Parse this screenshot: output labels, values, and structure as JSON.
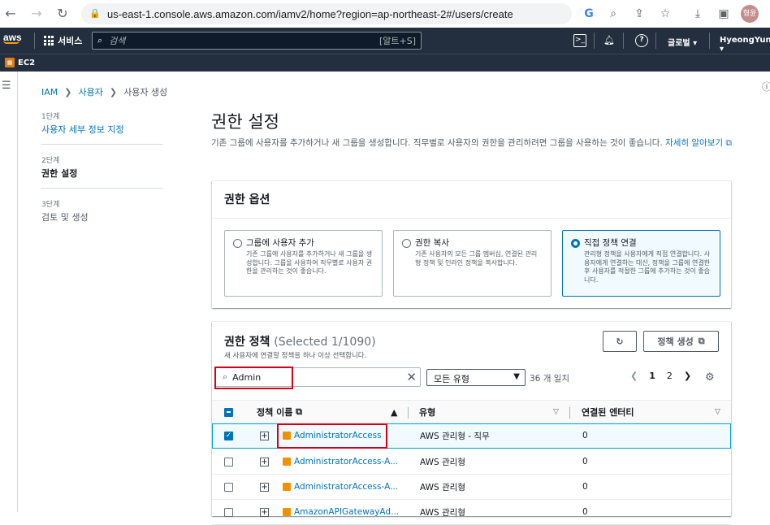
{
  "browser": {
    "url": "us-east-1.console.aws.amazon.com/iamv2/home?region=ap-northeast-2#/users/create",
    "profile": "형윤"
  },
  "nav": {
    "logo": "aws",
    "services": "서비스",
    "search_placeholder": "검색",
    "search_shortcut": "[알트+S]",
    "region": "글로벌",
    "user": "HyeongYun"
  },
  "favorites": {
    "ec2": "EC2"
  },
  "breadcrumb": {
    "iam": "IAM",
    "users": "사용자",
    "current": "사용자 생성"
  },
  "steps": [
    {
      "num": "1단계",
      "label": "사용자 세부 정보 지정"
    },
    {
      "num": "2단계",
      "label": "권한 설정"
    },
    {
      "num": "3단계",
      "label": "검토 및 생성"
    }
  ],
  "page": {
    "title": "권한 설정",
    "description": "기존 그룹에 사용자를 추가하거나 새 그룹을 생성합니다. 직무별로 사용자의 권한을 관리하려면 그룹을 사용하는 것이 좋습니다.",
    "learn_more": "자세히 알아보기"
  },
  "options_card": {
    "title": "권한 옵션",
    "options": [
      {
        "title": "그룹에 사용자 추가",
        "desc": "기존 그룹에 사용자를 추가하거나 새 그룹을 생성합니다. 그룹을 사용하여 직무별로 사용자 권한을 관리하는 것이 좋습니다.",
        "selected": false
      },
      {
        "title": "권한 복사",
        "desc": "기존 사용자의 모든 그룹 멤버십, 연결된 관리형 정책 및 인라인 정책을 복사합니다.",
        "selected": false
      },
      {
        "title": "직접 정책 연결",
        "desc": "관리형 정책을 사용자에게 직접 연결합니다. 사용자에게 연결하는 대신, 정책을 그룹에 연결한 후 사용자를 적절한 그룹에 추가하는 것이 좋습니다.",
        "selected": true
      }
    ]
  },
  "policies": {
    "title": "권한 정책",
    "selected": "(Selected 1/1090)",
    "subtitle": "새 사용자에 연결할 정책을 하나 이상 선택합니다.",
    "create_label": "정책 생성",
    "filter_value": "Admin",
    "type_filter": "모든 유형",
    "match_count": "36 개 일치",
    "pages": [
      "1",
      "2"
    ],
    "columns": {
      "name": "정책 이름",
      "type": "유형",
      "attached": "연결된 엔터티"
    },
    "rows": [
      {
        "name": "AdministratorAccess",
        "type": "AWS 관리형 - 직무",
        "attached": "0",
        "checked": true
      },
      {
        "name": "AdministratorAccess-A...",
        "type": "AWS 관리형",
        "attached": "0",
        "checked": false
      },
      {
        "name": "AdministratorAccess-A...",
        "type": "AWS 관리형",
        "attached": "0",
        "checked": false
      },
      {
        "name": "AmazonAPIGatewayAd...",
        "type": "AWS 관리형",
        "attached": "0",
        "checked": false
      }
    ]
  }
}
